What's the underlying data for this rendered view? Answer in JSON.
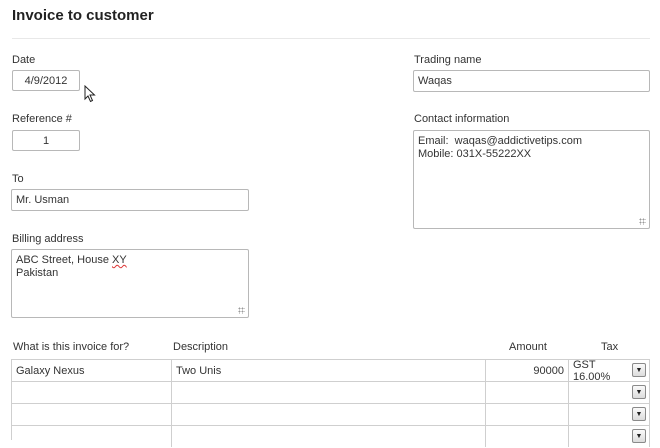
{
  "page": {
    "title": "Invoice to customer"
  },
  "form": {
    "date": {
      "label": "Date",
      "value": "4/9/2012"
    },
    "reference": {
      "label": "Reference #",
      "value": "1"
    },
    "to": {
      "label": "To",
      "value": "Mr. Usman"
    },
    "billing_address": {
      "label": "Billing address",
      "lines": [
        "ABC Street, House XY",
        "Pakistan"
      ]
    },
    "trading_name": {
      "label": "Trading name",
      "value": "Waqas"
    },
    "contact_information": {
      "label": "Contact information",
      "lines": [
        "Email:  waqas@addictivetips.com",
        "Mobile: 031X-55222XX"
      ]
    }
  },
  "table": {
    "headers": {
      "what": "What is this invoice for?",
      "description": "Description",
      "amount": "Amount",
      "tax": "Tax"
    },
    "rows": [
      {
        "what": "Galaxy Nexus",
        "description": "Two Unis",
        "amount": "90000",
        "tax": "GST 16.00%"
      },
      {
        "what": "",
        "description": "",
        "amount": "",
        "tax": ""
      },
      {
        "what": "",
        "description": "",
        "amount": "",
        "tax": ""
      },
      {
        "what": "",
        "description": "",
        "amount": "",
        "tax": ""
      }
    ]
  },
  "icons": {
    "dropdown": "chevron-down-icon",
    "cursor": "mouse-cursor-icon",
    "resize": "resize-grip-icon"
  }
}
